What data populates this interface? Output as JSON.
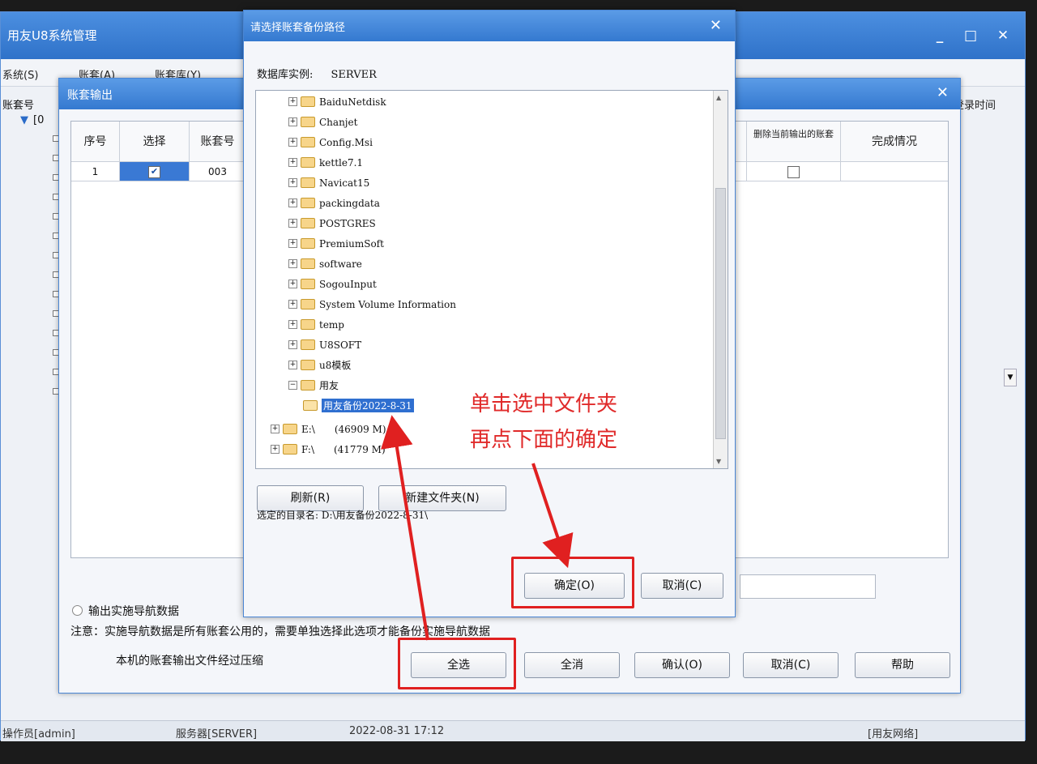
{
  "main_window": {
    "title": "用友U8系统管理",
    "controls": {
      "minimize": "_",
      "maximize": "□",
      "close": "✕"
    },
    "menu": [
      "系统(S)",
      "账套(A)",
      "账套库(Y)"
    ],
    "left_header": "账套号",
    "left_tree_root": "[0",
    "right_header": "登录时间"
  },
  "statusbar": {
    "operator": "操作员[admin]",
    "server": "服务器[SERVER]",
    "datetime": "2022-08-31 17:12",
    "brand": "[用友网络]"
  },
  "export_dialog": {
    "title": "账套输出",
    "close": "✕",
    "table": {
      "headers": [
        "序号",
        "选择",
        "账套号",
        "删除当前输出的账套",
        "完成情况"
      ],
      "rows": [
        {
          "index": "1",
          "selected": true,
          "account_no": "003",
          "delete": false,
          "status": ""
        }
      ]
    },
    "option_label": "输出实施导航数据",
    "note": "注意：实施导航数据是所有账套公用的，需要单独选择此选项才能备份实施导航数据",
    "compress_label": "本机的账套输出文件经过压缩",
    "buttons": {
      "select_all": "全选",
      "clear_all": "全消",
      "confirm": "确认(O)",
      "cancel": "取消(C)",
      "help": "帮助"
    }
  },
  "folder_dialog": {
    "title": "请选择账套备份路径",
    "close": "✕",
    "db_instance_label": "数据库实例:",
    "db_instance_value": "SERVER",
    "folders": [
      "BaiduNetdisk",
      "Chanjet",
      "Config.Msi",
      "kettle7.1",
      "Navicat15",
      "packingdata",
      "POSTGRES",
      "PremiumSoft",
      "software",
      "SogouInput",
      "System Volume Information",
      "temp",
      "U8SOFT",
      "u8模板",
      "用友"
    ],
    "selected_folder": "用友备份2022-8-31",
    "drives": [
      {
        "label": "E:\\",
        "size": "(46909 M)"
      },
      {
        "label": "F:\\",
        "size": "(41779 M)"
      }
    ],
    "buttons": {
      "refresh": "刷新(R)",
      "new_folder": "新建文件夹(N)",
      "ok": "确定(O)",
      "cancel": "取消(C)"
    },
    "selected_path_label": "选定的目录名:",
    "selected_path": "D:\\用友备份2022-8-31\\"
  },
  "annotation": {
    "line1": "单击选中文件夹",
    "line2": "再点下面的确定"
  },
  "colors": {
    "annotation_red": "#e02020",
    "titlebar_blue": "#3479d0"
  }
}
